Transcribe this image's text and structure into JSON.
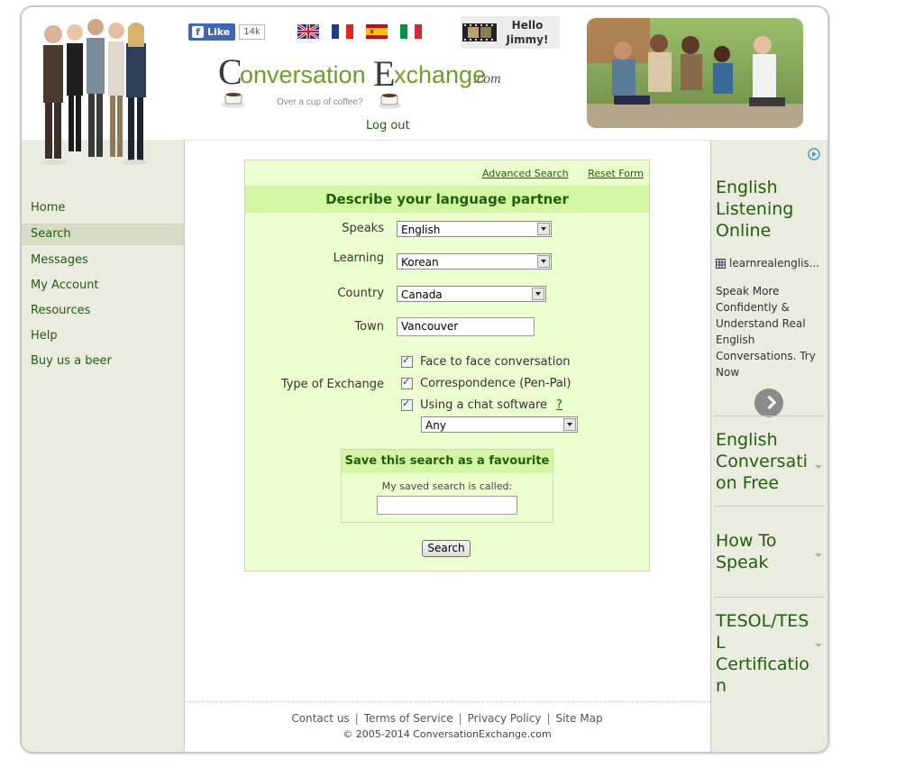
{
  "header": {
    "fb_like_label": "Like",
    "fb_like_count": "14k",
    "flags": [
      "uk-flag-icon",
      "france-flag-icon",
      "spain-flag-icon",
      "italy-flag-icon"
    ],
    "greeting_line1": "Hello",
    "greeting_line2": "Jimmy!",
    "logo_text": "ConversationExchange.com",
    "logo_tagline": "Over a cup of coffee?",
    "logout_label": "Log out"
  },
  "sidebar": {
    "items": [
      {
        "label": "Home"
      },
      {
        "label": "Search",
        "active": true
      },
      {
        "label": "Messages"
      },
      {
        "label": "My Account"
      },
      {
        "label": "Resources"
      },
      {
        "label": "Help"
      },
      {
        "label": "Buy us a beer"
      }
    ]
  },
  "form": {
    "advanced_search_label": "Advanced Search",
    "reset_form_label": "Reset Form",
    "title": "Describe your language partner",
    "speaks_label": "Speaks",
    "speaks_value": "English",
    "learning_label": "Learning",
    "learning_value": "Korean",
    "country_label": "Country",
    "country_value": "Canada",
    "town_label": "Town",
    "town_value": "Vancouver",
    "exchange_label": "Type of Exchange",
    "exchange_options": [
      {
        "label": "Face to face conversation",
        "checked": true
      },
      {
        "label": "Correspondence (Pen-Pal)",
        "checked": true
      },
      {
        "label": "Using a chat software",
        "checked": true
      }
    ],
    "help_mark": "?",
    "chat_software_value": "Any",
    "favourite_title": "Save this search as a favourite",
    "favourite_label": "My saved search is called:",
    "favourite_value": "",
    "search_button": "Search"
  },
  "footer": {
    "links": [
      "Contact us",
      "Terms of Service",
      "Privacy Policy",
      "Site Map"
    ],
    "separator": "|",
    "copyright": "© 2005-2014 ConversationExchange.com"
  },
  "ads": {
    "main_title": "English Listening Online",
    "main_url": "learnrealenglis...",
    "main_body": "Speak More Confidently & Understand Real English Conversations. Try Now",
    "links": [
      "English Conversation Free",
      "How To Speak",
      "TESOL/TESL Certification"
    ]
  },
  "colors": {
    "brand_green": "#1f5f0b",
    "panel_bg": "#ebffcf",
    "panel_title_bg": "#d4f7a3",
    "sidebar_bg": "#e9ecde"
  }
}
